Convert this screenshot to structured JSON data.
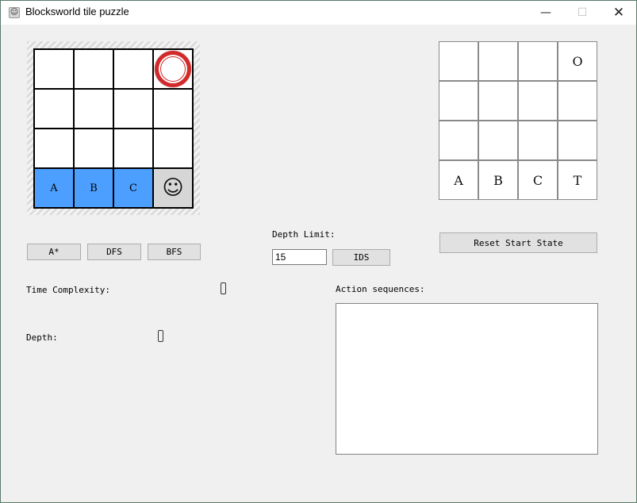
{
  "window": {
    "title": "Blocksworld tile puzzle",
    "icon": "smiley-app-icon",
    "controls": {
      "minimize": "—",
      "maximize": "☐",
      "close": "✕"
    }
  },
  "start_board": {
    "rows": [
      [
        "",
        "",
        "",
        ""
      ],
      [
        "",
        "",
        "",
        ""
      ],
      [
        "",
        "",
        "",
        ""
      ],
      [
        "A",
        "B",
        "C",
        ""
      ]
    ],
    "goal_marker": "red-ring-icon",
    "agent": "☺",
    "tile_color": "#4d9fff",
    "agent_cell_color": "#d6d6d6",
    "marker_color": "#d12a2a"
  },
  "goal_board": {
    "rows": [
      [
        "",
        "",
        "",
        "O"
      ],
      [
        "",
        "",
        "",
        ""
      ],
      [
        "",
        "",
        "",
        ""
      ],
      [
        "A",
        "B",
        "C",
        "T"
      ]
    ]
  },
  "buttons": {
    "astar": "A*",
    "dfs": "DFS",
    "bfs": "BFS",
    "ids": "IDS",
    "reset": "Reset Start State"
  },
  "depth_limit": {
    "label": "Depth Limit:",
    "value": "15"
  },
  "time_complexity": {
    "label": "Time Complexity:"
  },
  "depth": {
    "label": "Depth:"
  },
  "actions": {
    "label": "Action sequences:"
  }
}
